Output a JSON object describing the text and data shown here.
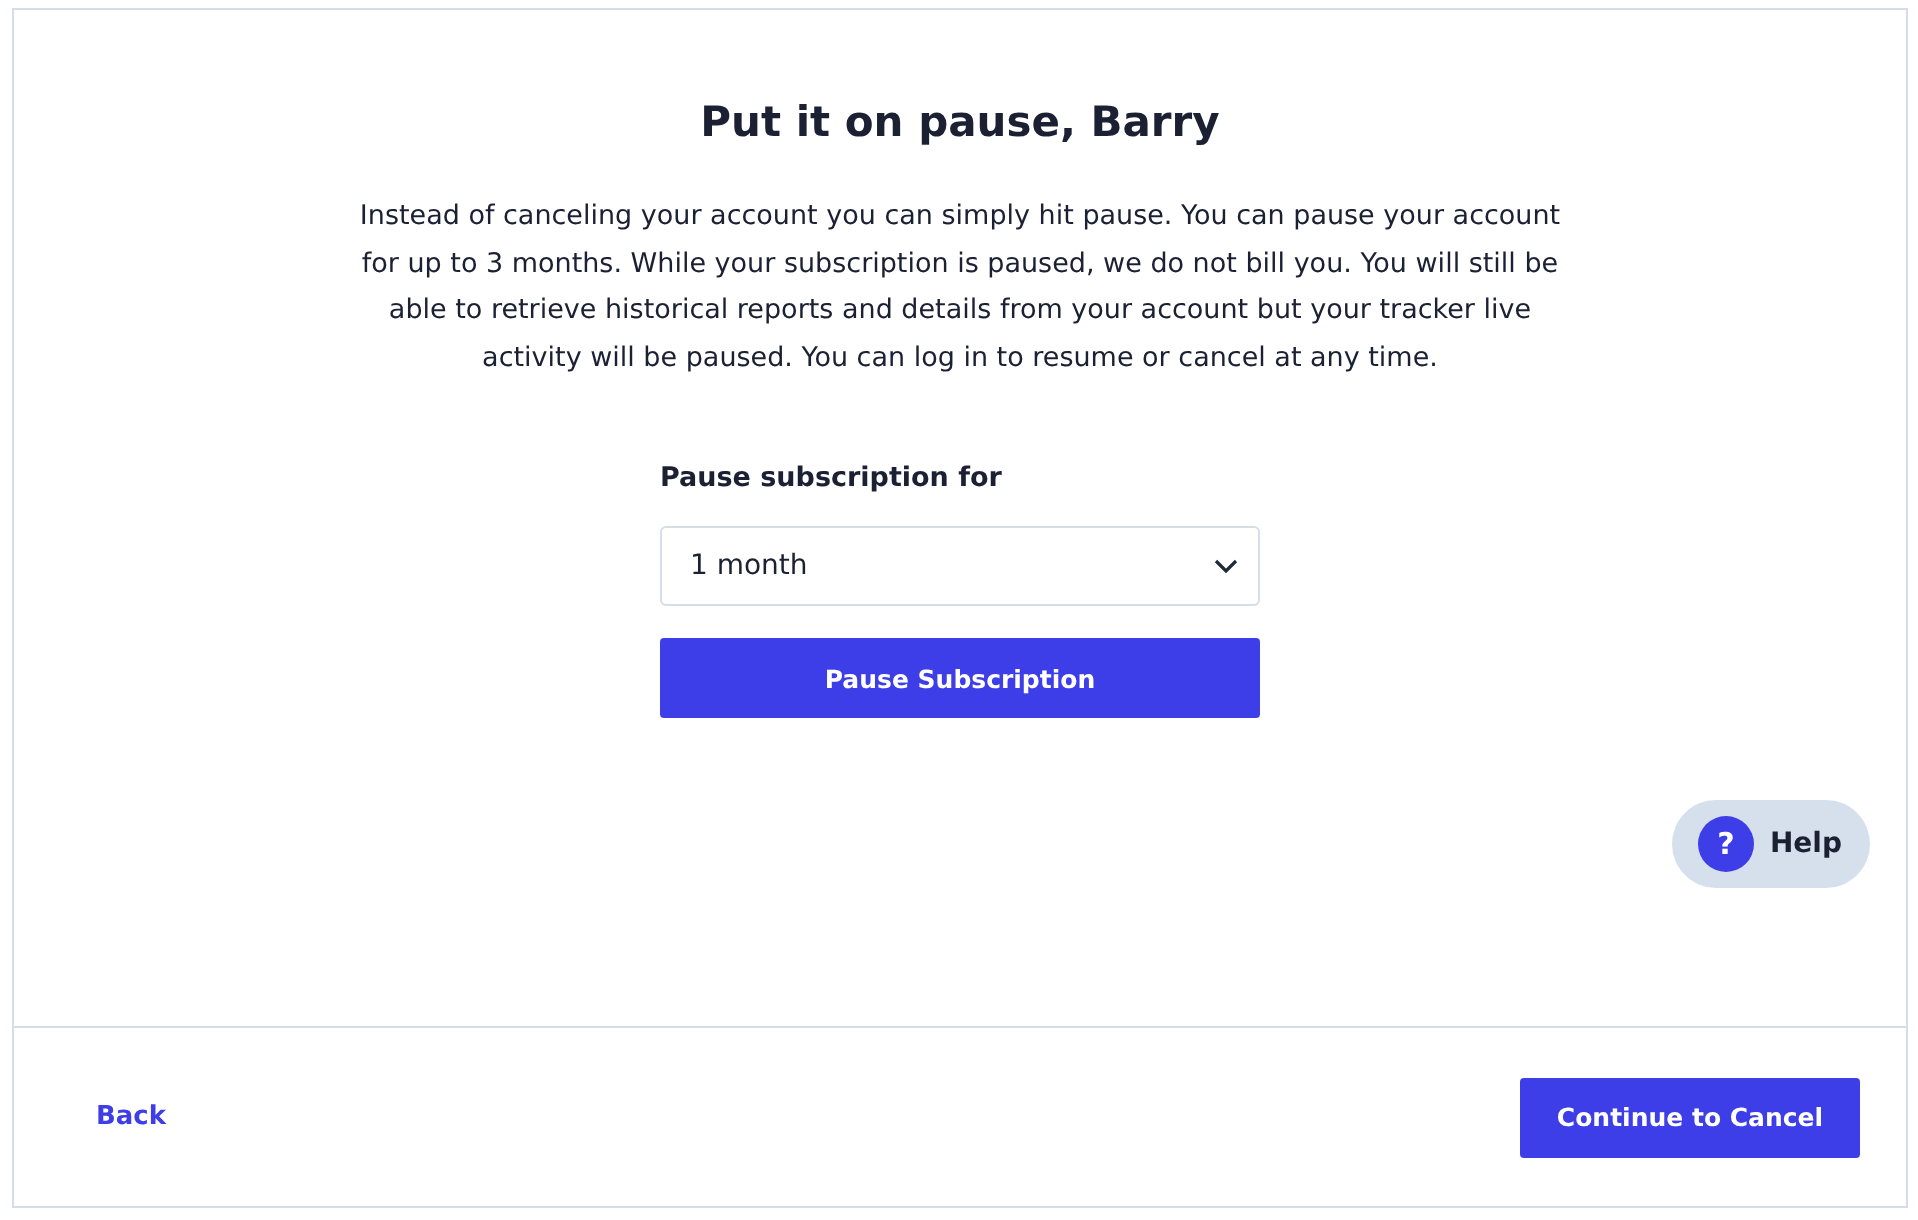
{
  "title": "Put it on pause, Barry",
  "description": "Instead of canceling your account you can simply hit pause. You can pause your account for up to 3 months. While your subscription is paused, we do not bill you. You will still be able to retrieve historical reports and details from your account but your tracker live activity will be paused. You can log in to resume or cancel at any time.",
  "pause_field": {
    "label": "Pause subscription for",
    "value": "1 month"
  },
  "pause_button": "Pause Subscription",
  "help": {
    "icon": "?",
    "label": "Help"
  },
  "footer": {
    "back": "Back",
    "continue": "Continue to Cancel"
  }
}
